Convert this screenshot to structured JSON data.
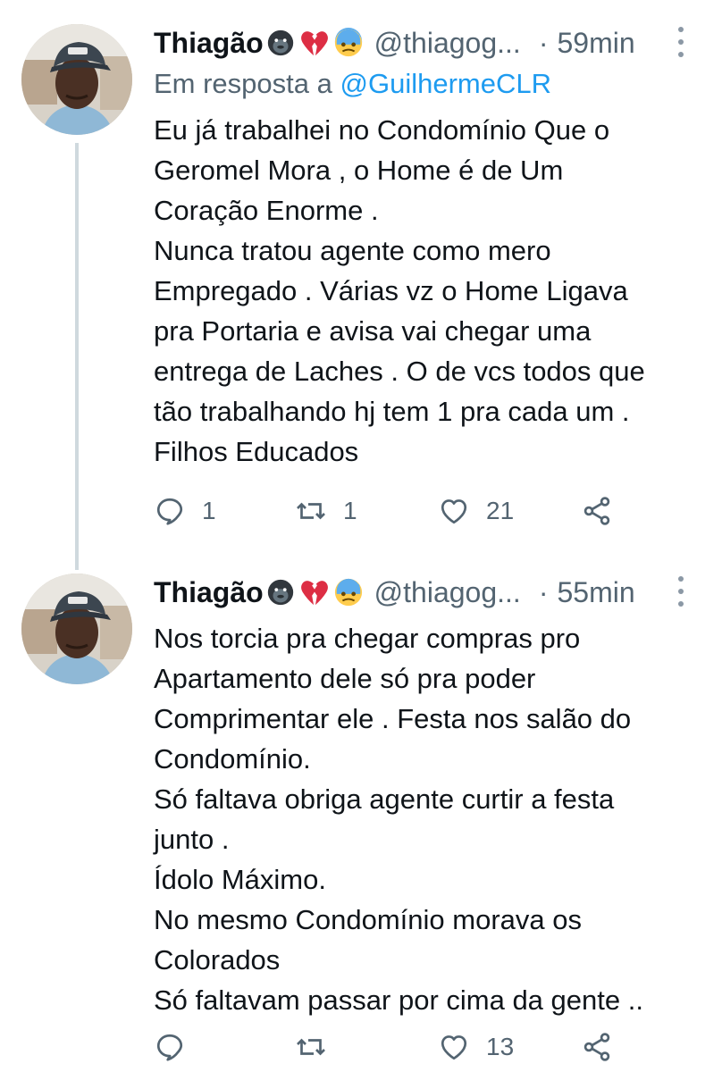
{
  "tweets": [
    {
      "author": "Thiagão",
      "emojis": [
        "gorilla",
        "broken-heart",
        "cold-sweat-face"
      ],
      "handle": "@thiagog...",
      "separator": "·",
      "time": "59min",
      "reply_prefix": "Em resposta a",
      "reply_mention": "@GuilhermeCLR",
      "lines": [
        "Eu já trabalhei no Condomínio Que o",
        "Geromel Mora , o Home é de Um",
        "Coração Enorme .",
        "Nunca tratou agente como mero",
        "Empregado . Várias vz o Home Ligava",
        "pra Portaria e avisa vai chegar uma",
        "entrega de Laches . O de vcs todos que",
        "tão trabalhando hj tem 1 pra cada um .",
        "Filhos Educados"
      ],
      "replies": "1",
      "retweets": "1",
      "likes": "21"
    },
    {
      "author": "Thiagão",
      "emojis": [
        "gorilla",
        "broken-heart",
        "cold-sweat-face"
      ],
      "handle": "@thiagog...",
      "separator": "·",
      "time": "55min",
      "lines": [
        "Nos torcia pra chegar compras pro",
        "Apartamento dele só pra poder",
        "Comprimentar ele . Festa nos salão do",
        "Condomínio.",
        "Só faltava obriga agente curtir a festa",
        "junto .",
        "Ídolo Máximo.",
        "No mesmo Condomínio morava os",
        "Colorados",
        "Só faltavam passar por cima da gente .."
      ],
      "replies": "",
      "retweets": "",
      "likes": "13"
    }
  ],
  "colors": {
    "text": "#0f1419",
    "secondary": "#536471",
    "link": "#1d9bf0",
    "thread_line": "#cfd9de",
    "heart": "#e0245e",
    "sweat_face": "#5dadec"
  }
}
